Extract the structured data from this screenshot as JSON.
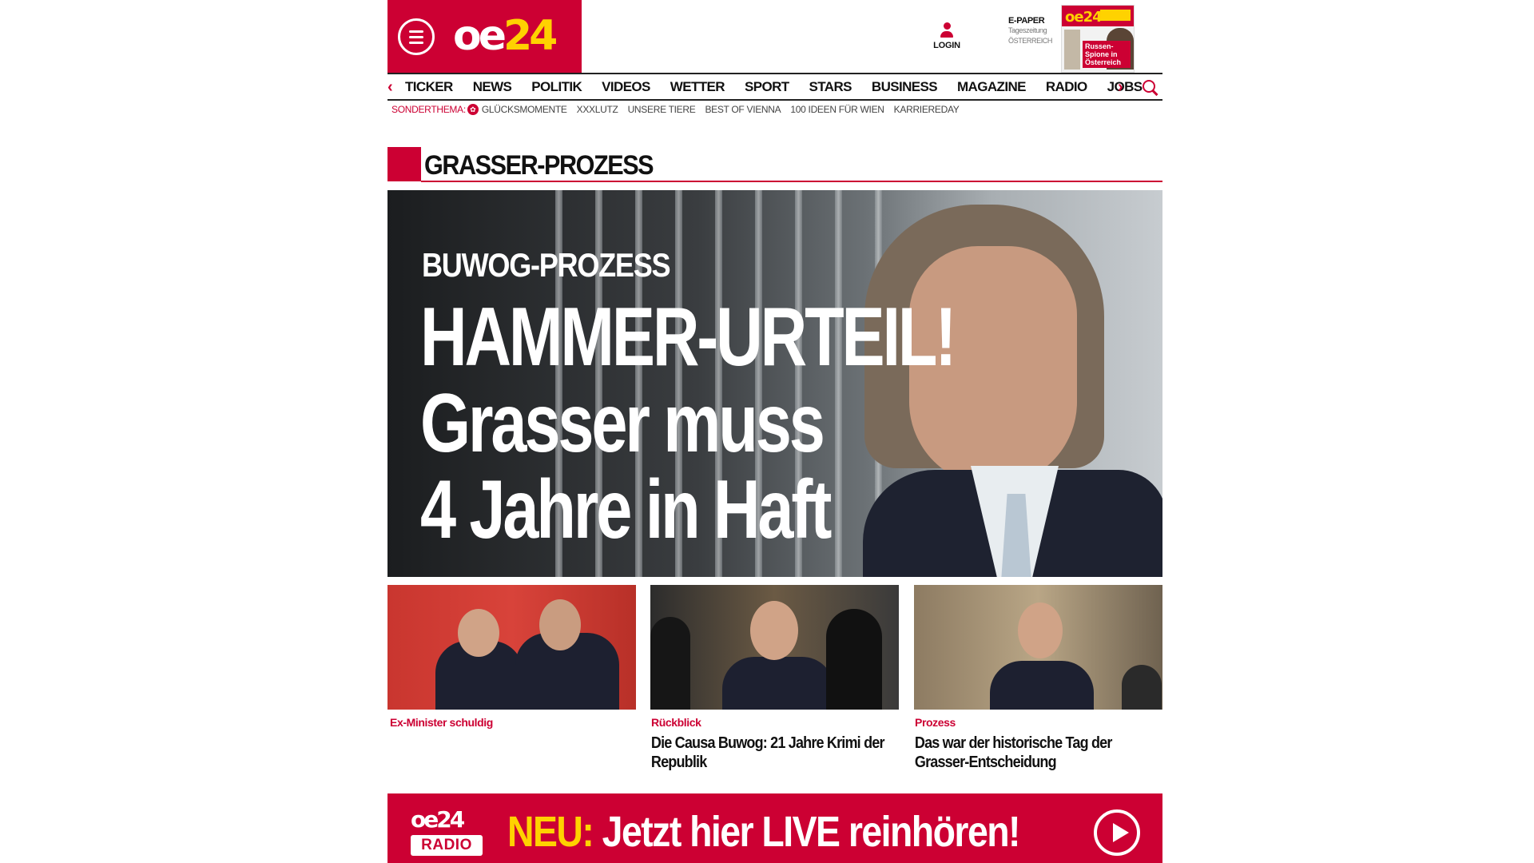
{
  "header": {
    "logo": {
      "oe": "oe",
      "num": "24"
    },
    "login_label": "LOGIN",
    "epaper": {
      "title": "E-PAPER",
      "subtitle": "Tageszeitung",
      "edition": "ÖSTERREICH",
      "cover_logo": "oe24",
      "cover_headline": "Russen-Spione in Österreich"
    }
  },
  "nav": {
    "items": [
      "TICKER",
      "NEWS",
      "POLITIK",
      "VIDEOS",
      "WETTER",
      "SPORT",
      "STARS",
      "BUSINESS",
      "MAGAZINE",
      "RADIO",
      "JOBS"
    ],
    "prev_icon": "‹",
    "next_icon": "›"
  },
  "subnav": {
    "label": "SONDERTHEMA:",
    "items": [
      "GLÜCKSMOMENTE",
      "XXXLUTZ",
      "UNSERE TIERE",
      "BEST OF VIENNA",
      "100 IDEEN FÜR WIEN",
      "KARRIEREDAY"
    ]
  },
  "section": {
    "title": "GRASSER-PROZESS"
  },
  "hero": {
    "kicker": "BUWOG-PROZESS",
    "title_lines": [
      "HAMMER-URTEIL!",
      "Grasser muss",
      "4 Jahre in Haft"
    ]
  },
  "teasers": [
    {
      "kicker": "Ex-Minister schuldig",
      "title": ""
    },
    {
      "kicker": "Rückblick",
      "title": "Die Causa Buwog: 21 Jahre Krimi der Republik"
    },
    {
      "kicker": "Prozess",
      "title": "Das war der historische Tag der Grasser-Entscheidung"
    }
  ],
  "radio_banner": {
    "logo_top": "oe24",
    "logo_box": "RADIO",
    "neu": "NEU:",
    "text": "Jetzt hier LIVE reinhören!"
  },
  "colors": {
    "brand_red": "#cc0033",
    "brand_yellow": "#ffd200"
  }
}
